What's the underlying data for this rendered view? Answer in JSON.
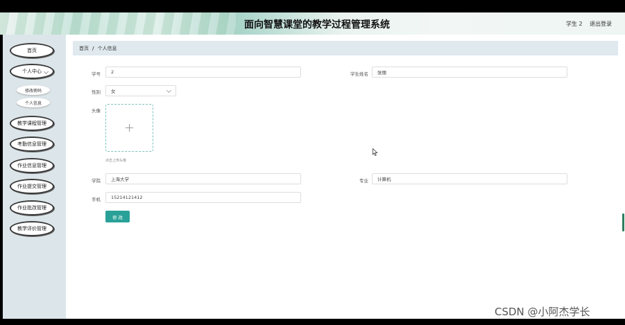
{
  "header": {
    "title": "面向智慧课堂的教学过程管理系统",
    "user_label": "学生 2",
    "logout_label": "退出登录"
  },
  "sidebar": {
    "items": [
      {
        "label": "首页"
      },
      {
        "label": "个人中心"
      },
      {
        "label": "教学课程管理"
      },
      {
        "label": "考勤信息管理"
      },
      {
        "label": "作业信息管理"
      },
      {
        "label": "作业提交管理"
      },
      {
        "label": "作业批改管理"
      },
      {
        "label": "教学评价管理"
      }
    ],
    "sub_items": [
      {
        "label": "修改密码"
      },
      {
        "label": "个人信息"
      }
    ]
  },
  "breadcrumb": {
    "home": "首页",
    "separator": "/",
    "current": "个人信息"
  },
  "form": {
    "student_id": {
      "label": "学号",
      "value": "2"
    },
    "student_name": {
      "label": "学生姓名",
      "value": "张丽"
    },
    "gender": {
      "label": "性别",
      "value": "女"
    },
    "avatar": {
      "label": "头像",
      "hint": "点击上传头像"
    },
    "college": {
      "label": "学院",
      "value": "上海大学"
    },
    "major": {
      "label": "专业",
      "value": "计算机"
    },
    "phone": {
      "label": "手机",
      "value": "15214121412"
    },
    "submit_label": "修 改"
  },
  "watermark": "CSDN @小阿杰学长",
  "colors": {
    "accent": "#2aa198",
    "sidebar_bg": "#dce6ea",
    "breadcrumb_bg": "#dfe9ee"
  }
}
